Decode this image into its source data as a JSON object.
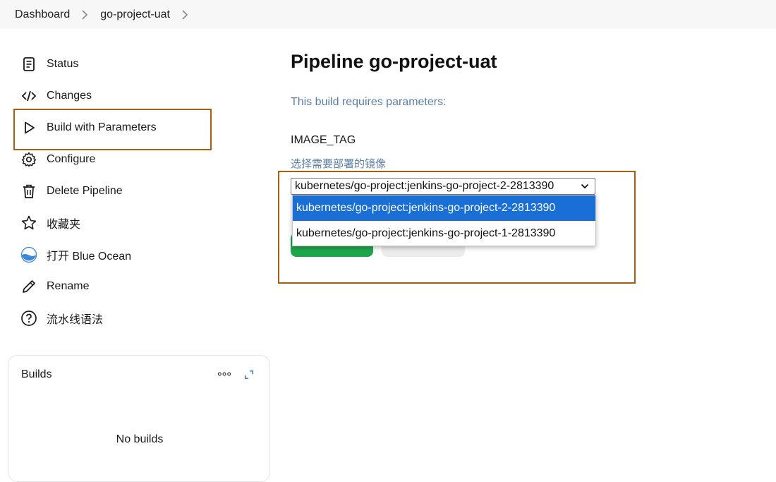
{
  "breadcrumb": {
    "items": [
      "Dashboard",
      "go-project-uat"
    ]
  },
  "sidebar": {
    "items": [
      {
        "label": "Status",
        "icon": "document-icon"
      },
      {
        "label": "Changes",
        "icon": "code-icon"
      },
      {
        "label": "Build with Parameters",
        "icon": "play-icon"
      },
      {
        "label": "Configure",
        "icon": "gear-icon"
      },
      {
        "label": "Delete Pipeline",
        "icon": "trash-icon"
      },
      {
        "label": "收藏夹",
        "icon": "star-icon"
      },
      {
        "label": "打开 Blue Ocean",
        "icon": "blue-ocean-icon"
      },
      {
        "label": "Rename",
        "icon": "pencil-icon"
      },
      {
        "label": "流水线语法",
        "icon": "help-icon"
      }
    ]
  },
  "builds": {
    "title": "Builds",
    "empty_text": "No builds"
  },
  "main": {
    "title": "Pipeline go-project-uat",
    "requires_text": "This build requires parameters:",
    "param": {
      "name": "IMAGE_TAG",
      "description": "选择需要部署的镜像",
      "selected_value": "kubernetes/go-project:jenkins-go-project-2-2813390",
      "options": [
        "kubernetes/go-project:jenkins-go-project-2-2813390",
        "kubernetes/go-project:jenkins-go-project-1-2813390"
      ]
    }
  },
  "colors": {
    "accent_highlight_border": "#a65f10",
    "build_button": "#1ea64b",
    "selected_option": "#1a6fd6",
    "link_blue": "#5a7ea8"
  }
}
